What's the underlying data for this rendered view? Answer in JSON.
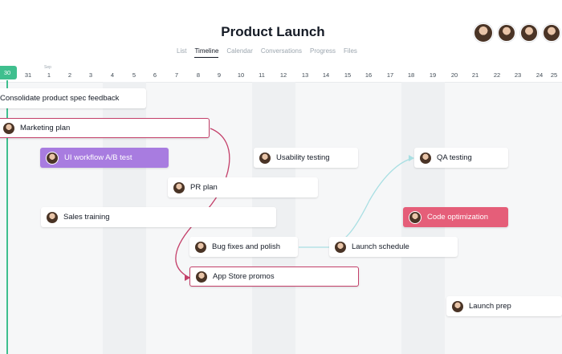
{
  "page": {
    "title": "Product Launch",
    "tabs": [
      "List",
      "Timeline",
      "Calendar",
      "Conversations",
      "Progress",
      "Files"
    ],
    "active_tab": "Timeline",
    "member_avatars": [
      "member-avatar",
      "member-avatar",
      "member-avatar",
      "member-avatar"
    ]
  },
  "timeline": {
    "month_label": "Sep",
    "today_label": "30",
    "dates": [
      "31",
      "1",
      "2",
      "3",
      "4",
      "5",
      "6",
      "7",
      "8",
      "9",
      "10",
      "11",
      "12",
      "13",
      "14",
      "15",
      "16",
      "17",
      "18",
      "19",
      "20",
      "21",
      "22",
      "23",
      "24",
      "25"
    ]
  },
  "tasks": [
    {
      "label": "Consolidate product spec feedback"
    },
    {
      "label": "Marketing plan"
    },
    {
      "label": "UI workflow A/B test"
    },
    {
      "label": "Usability testing"
    },
    {
      "label": "QA testing"
    },
    {
      "label": "PR plan"
    },
    {
      "label": "Sales training"
    },
    {
      "label": "Code optimization"
    },
    {
      "label": "Bug fixes and polish"
    },
    {
      "label": "Launch schedule"
    },
    {
      "label": "App Store promos"
    },
    {
      "label": "Launch prep"
    }
  ],
  "colors": {
    "today": "#3fbf8e",
    "selected_border": "#c4406a",
    "purple_task": "#a87ce0",
    "red_task": "#e55e79",
    "dependency_pink": "#c4406a",
    "dependency_teal": "#a9dfe3"
  }
}
